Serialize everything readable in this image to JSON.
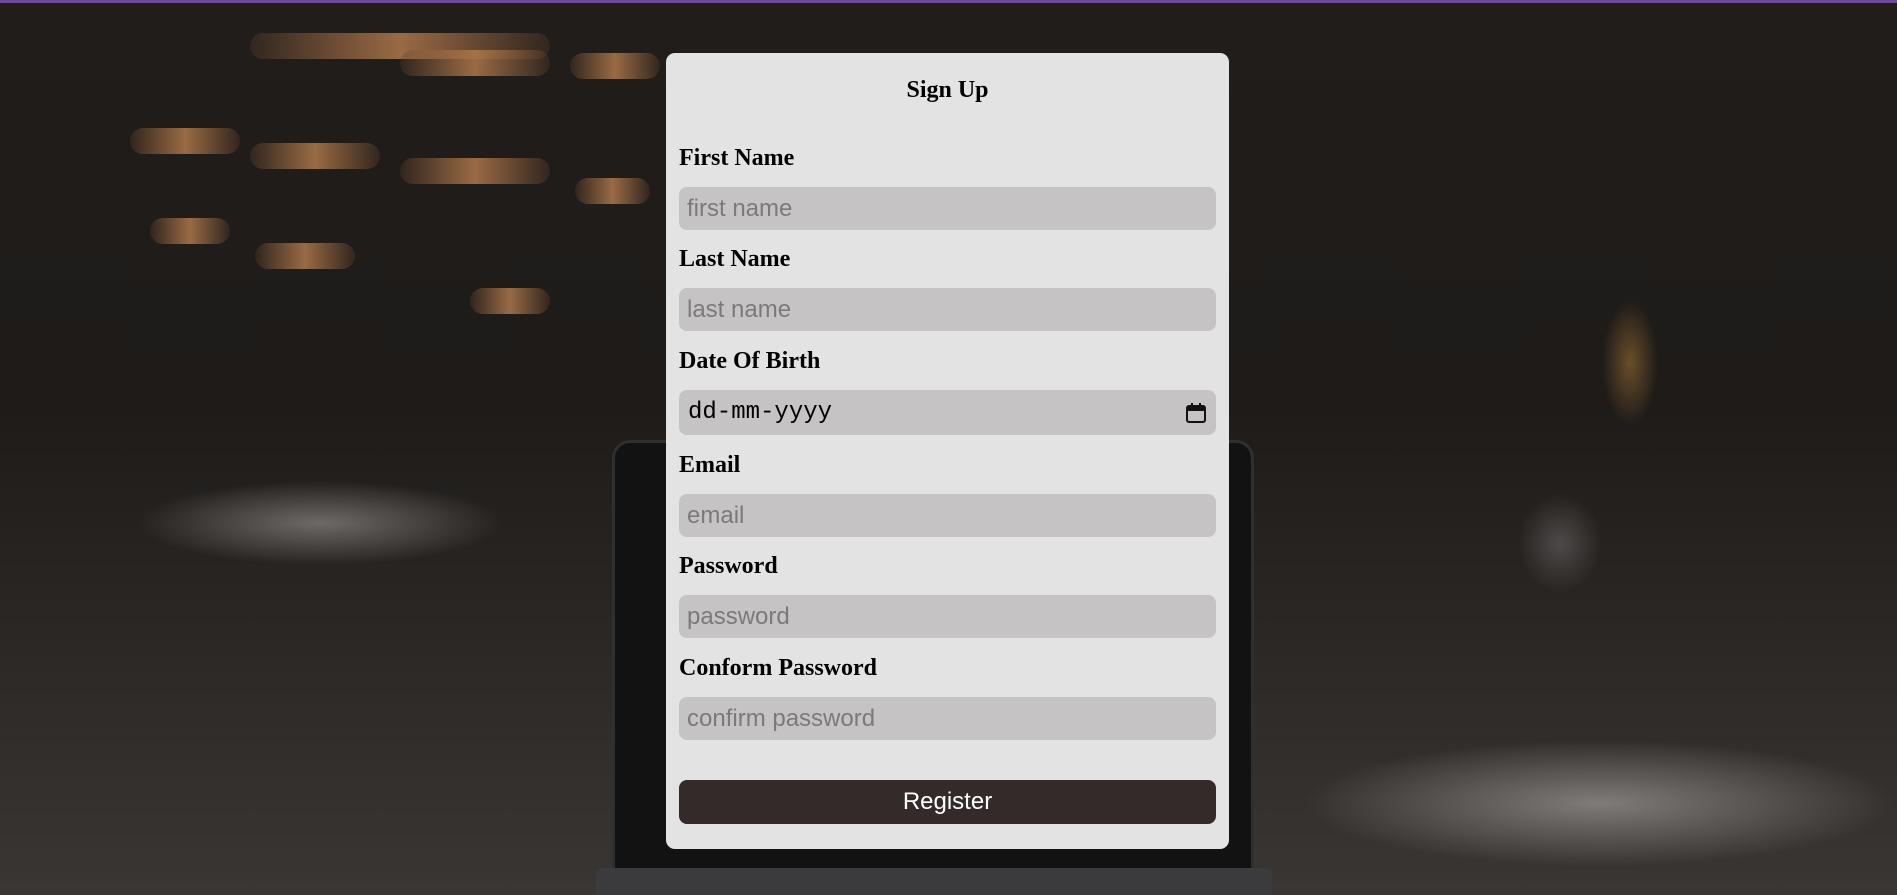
{
  "form": {
    "title": "Sign Up",
    "fields": [
      {
        "label": "First Name",
        "placeholder": "first name"
      },
      {
        "label": "Last Name",
        "placeholder": "last name"
      },
      {
        "label": "Date Of Birth",
        "value": "dd-mm-yyyy"
      },
      {
        "label": "Email",
        "placeholder": "email"
      },
      {
        "label": "Password",
        "placeholder": "password"
      },
      {
        "label": "Conform Password",
        "placeholder": "confirm password"
      }
    ],
    "submit_label": "Register"
  },
  "colors": {
    "card_background": "#e3e3e3",
    "input_background": "#c5c3c4",
    "button_background": "#342a2a",
    "top_strip": "#6b4a9a"
  },
  "icons": {
    "date_picker": "calendar-icon"
  }
}
